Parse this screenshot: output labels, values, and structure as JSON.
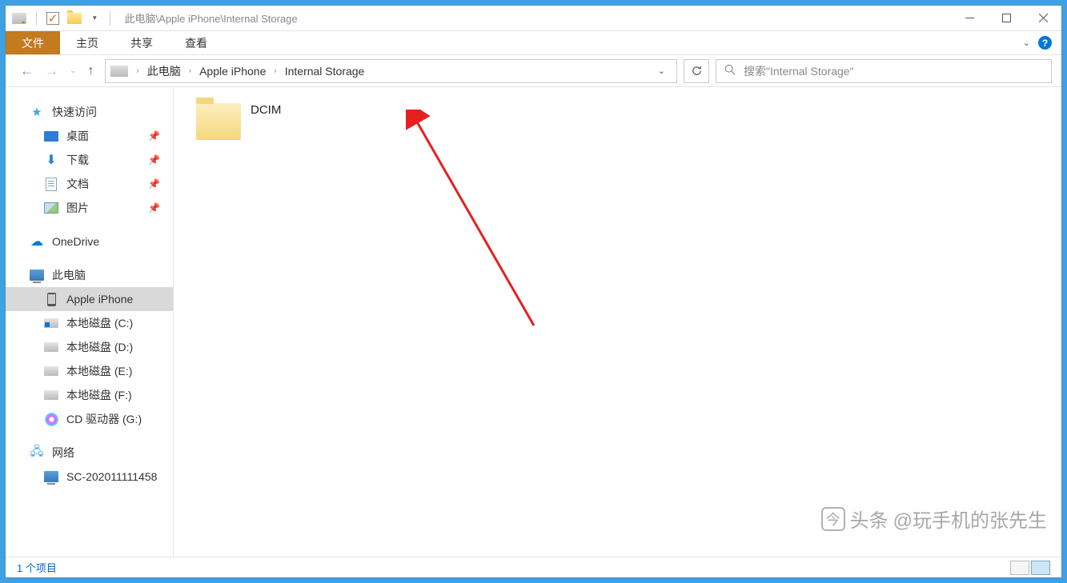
{
  "titlebar": {
    "path": "此电脑\\Apple iPhone\\Internal Storage"
  },
  "ribbon": {
    "file": "文件",
    "home": "主页",
    "share": "共享",
    "view": "查看"
  },
  "breadcrumbs": {
    "root": "此电脑",
    "device": "Apple iPhone",
    "storage": "Internal Storage"
  },
  "search": {
    "placeholder": "搜索\"Internal Storage\""
  },
  "sidebar": {
    "quick_access": "快速访问",
    "desktop": "桌面",
    "downloads": "下载",
    "documents": "文档",
    "pictures": "图片",
    "onedrive": "OneDrive",
    "this_pc": "此电脑",
    "apple_iphone": "Apple iPhone",
    "disk_c": "本地磁盘 (C:)",
    "disk_d": "本地磁盘 (D:)",
    "disk_e": "本地磁盘 (E:)",
    "disk_f": "本地磁盘 (F:)",
    "cd_g": "CD 驱动器 (G:)",
    "network": "网络",
    "network_pc": "SC-202011111458"
  },
  "content": {
    "folder_name": "DCIM"
  },
  "statusbar": {
    "count": "1 个项目"
  },
  "watermark": {
    "prefix": "头条",
    "text": "@玩手机的张先生"
  }
}
